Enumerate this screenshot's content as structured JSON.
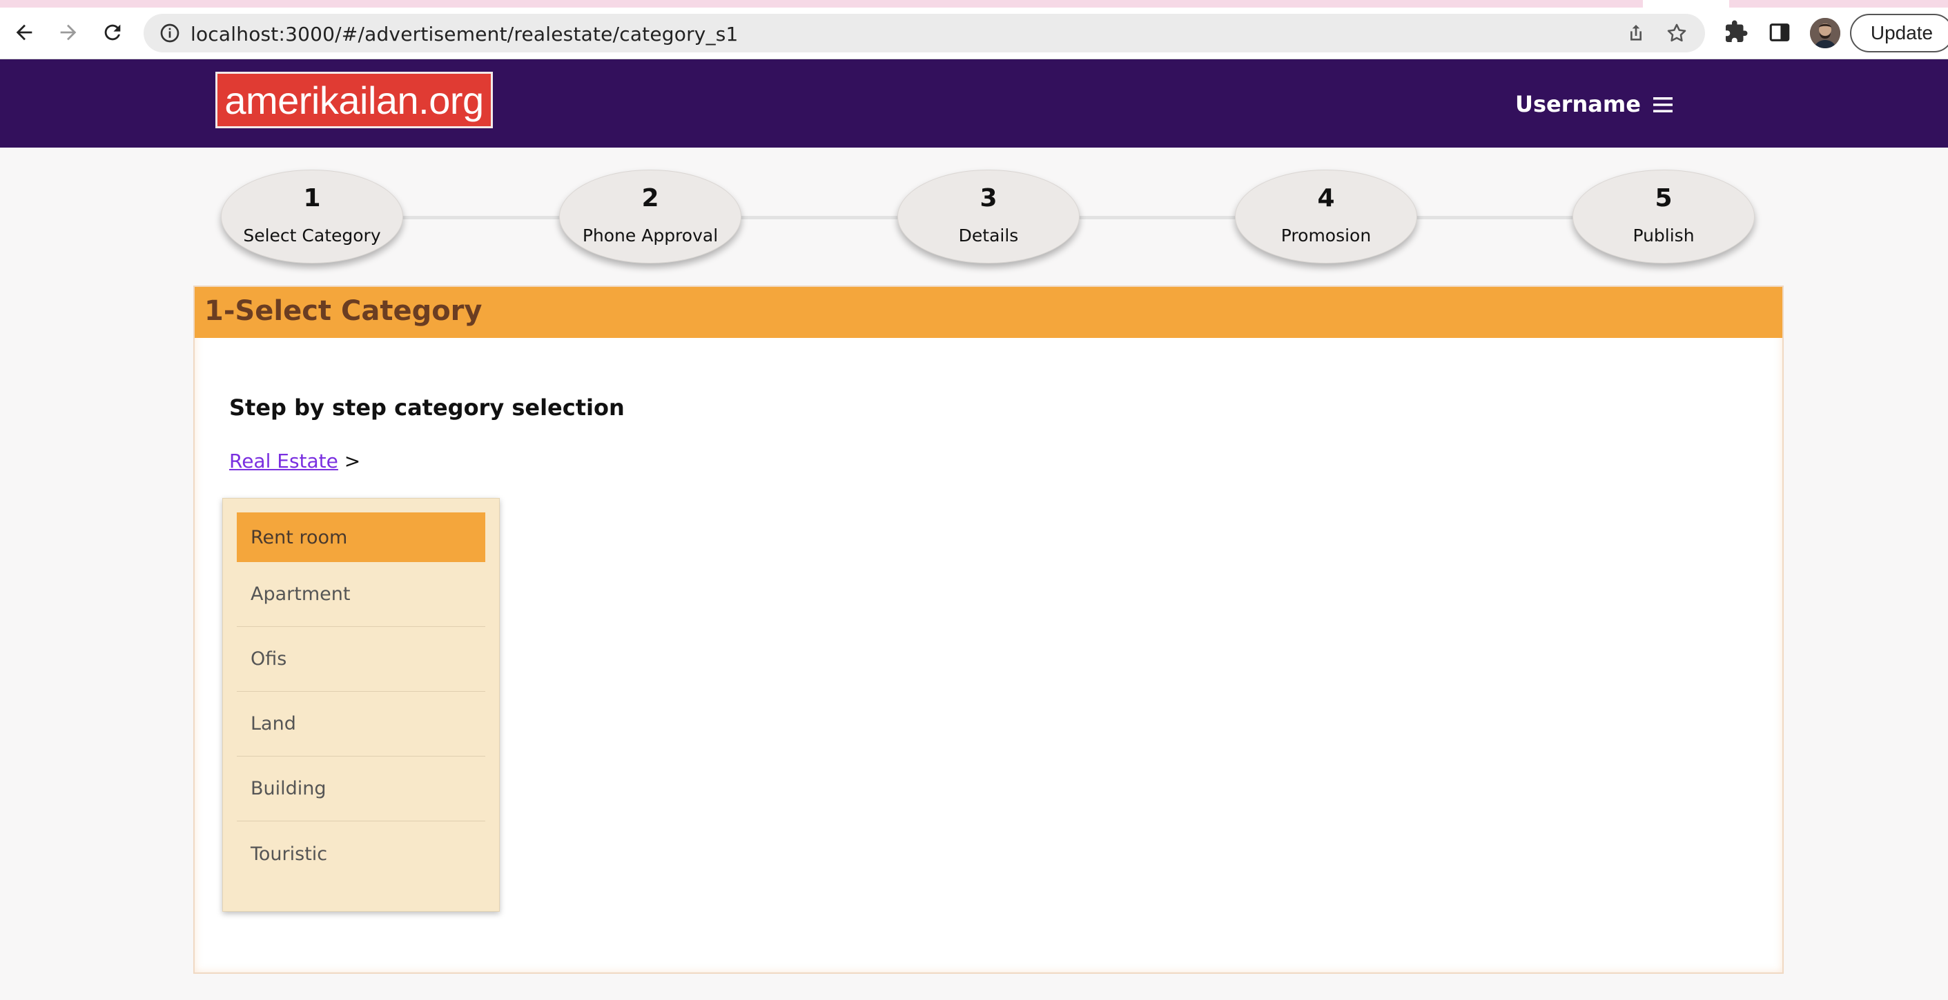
{
  "browser": {
    "url": "localhost:3000/#/advertisement/realestate/category_s1",
    "update_label": "Update"
  },
  "header": {
    "logo_text": "amerikailan.org",
    "username": "Username"
  },
  "steps": [
    {
      "num": "1",
      "label": "Select Category"
    },
    {
      "num": "2",
      "label": "Phone Approval"
    },
    {
      "num": "3",
      "label": "Details"
    },
    {
      "num": "4",
      "label": "Promosion"
    },
    {
      "num": "5",
      "label": "Publish"
    }
  ],
  "panel": {
    "title": "1-Select Category",
    "subtitle": "Step by step category selection",
    "breadcrumb_link": "Real Estate",
    "breadcrumb_sep": ">"
  },
  "categories": [
    {
      "label": "Rent room",
      "selected": true
    },
    {
      "label": "Apartment",
      "selected": false
    },
    {
      "label": "Ofis",
      "selected": false
    },
    {
      "label": "Land",
      "selected": false
    },
    {
      "label": "Building",
      "selected": false
    },
    {
      "label": "Touristic",
      "selected": false
    }
  ],
  "colors": {
    "brand_header": "#33105c",
    "logo_bg": "#e03b33",
    "accent": "#f4a63c",
    "list_bg": "#f8e8c9",
    "link": "#7a2fe0"
  }
}
